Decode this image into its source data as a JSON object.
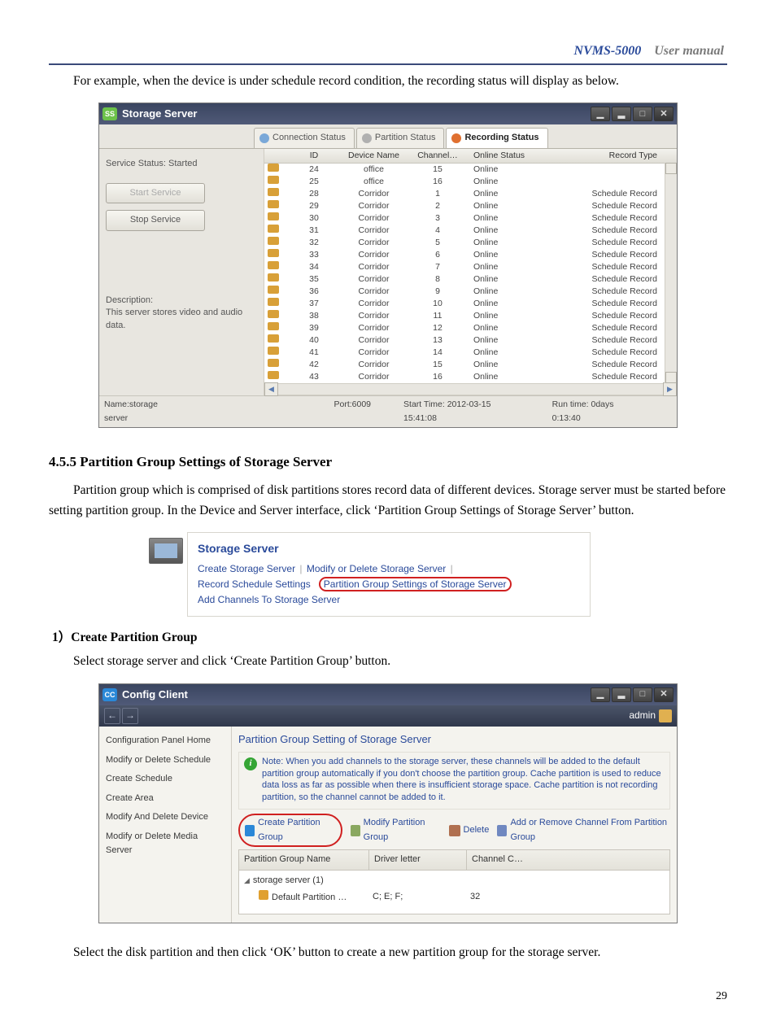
{
  "header": {
    "product": "NVMS-5000",
    "label": "User manual"
  },
  "intro": "For example, when the device is under schedule record condition, the recording status will display as below.",
  "ss_window": {
    "title": "Storage Server",
    "tabs": {
      "conn": "Connection Status",
      "part": "Partition Status",
      "rec": "Recording Status"
    },
    "service_status_label": "Service Status: Started",
    "start_btn": "Start Service",
    "stop_btn": "Stop Service",
    "desc_label": "Description:",
    "desc_text": "This server stores video and audio data.",
    "columns": {
      "id": "ID",
      "dev": "Device Name",
      "chan": "Channel…",
      "online": "Online Status",
      "rec": "Record Type"
    },
    "footer": {
      "name": "Name:storage server",
      "port": "Port:6009",
      "start": "Start Time: 2012-03-15 15:41:08",
      "run": "Run time: 0days 0:13:40"
    },
    "rows": [
      {
        "id": "24",
        "dev": "office",
        "chan": "15",
        "online": "Online",
        "rec": ""
      },
      {
        "id": "25",
        "dev": "office",
        "chan": "16",
        "online": "Online",
        "rec": ""
      },
      {
        "id": "28",
        "dev": "Corridor",
        "chan": "1",
        "online": "Online",
        "rec": "Schedule Record"
      },
      {
        "id": "29",
        "dev": "Corridor",
        "chan": "2",
        "online": "Online",
        "rec": "Schedule Record"
      },
      {
        "id": "30",
        "dev": "Corridor",
        "chan": "3",
        "online": "Online",
        "rec": "Schedule Record"
      },
      {
        "id": "31",
        "dev": "Corridor",
        "chan": "4",
        "online": "Online",
        "rec": "Schedule Record"
      },
      {
        "id": "32",
        "dev": "Corridor",
        "chan": "5",
        "online": "Online",
        "rec": "Schedule Record"
      },
      {
        "id": "33",
        "dev": "Corridor",
        "chan": "6",
        "online": "Online",
        "rec": "Schedule Record"
      },
      {
        "id": "34",
        "dev": "Corridor",
        "chan": "7",
        "online": "Online",
        "rec": "Schedule Record"
      },
      {
        "id": "35",
        "dev": "Corridor",
        "chan": "8",
        "online": "Online",
        "rec": "Schedule Record"
      },
      {
        "id": "36",
        "dev": "Corridor",
        "chan": "9",
        "online": "Online",
        "rec": "Schedule Record"
      },
      {
        "id": "37",
        "dev": "Corridor",
        "chan": "10",
        "online": "Online",
        "rec": "Schedule Record"
      },
      {
        "id": "38",
        "dev": "Corridor",
        "chan": "11",
        "online": "Online",
        "rec": "Schedule Record"
      },
      {
        "id": "39",
        "dev": "Corridor",
        "chan": "12",
        "online": "Online",
        "rec": "Schedule Record"
      },
      {
        "id": "40",
        "dev": "Corridor",
        "chan": "13",
        "online": "Online",
        "rec": "Schedule Record"
      },
      {
        "id": "41",
        "dev": "Corridor",
        "chan": "14",
        "online": "Online",
        "rec": "Schedule Record"
      },
      {
        "id": "42",
        "dev": "Corridor",
        "chan": "15",
        "online": "Online",
        "rec": "Schedule Record"
      },
      {
        "id": "43",
        "dev": "Corridor",
        "chan": "16",
        "online": "Online",
        "rec": "Schedule Record"
      }
    ]
  },
  "section": "4.5.5 Partition Group Settings of Storage Server",
  "section_para": "Partition group which is comprised of disk partitions stores record data of different devices. Storage server must be started before setting partition group. In the Device and Server interface, click ‘Partition Group Settings of Storage Server’ button.",
  "links_block": {
    "title": "Storage Server",
    "create": "Create Storage Server",
    "modify": "Modify or Delete Storage Server",
    "sched": "Record Schedule Settings",
    "part": "Partition Group Settings of Storage Server",
    "add": "Add Channels To Storage Server"
  },
  "sub1_h": "1）Create Partition Group",
  "sub1_p": "Select storage server and click ‘Create Partition Group’ button.",
  "cc_window": {
    "title": "Config Client",
    "user": "admin",
    "side": [
      "Configuration Panel Home",
      "Modify or Delete Schedule",
      "Create Schedule",
      "Create Area",
      "Modify And Delete Device",
      "Modify or Delete Media Server"
    ],
    "pg_title": "Partition Group Setting of Storage Server",
    "note": "Note: When you add channels to the storage server, these channels will be added to the default partition group automatically if you don't choose the partition group. Cache partition is used to reduce data loss as far as possible when there is insufficient storage space. Cache partition is not recording partition, so the channel cannot be added to it.",
    "toolbar": {
      "create": "Create Partition Group",
      "modify": "Modify Partition Group",
      "delete": "Delete",
      "addrem": "Add or Remove Channel From Partition Group"
    },
    "cols": {
      "name": "Partition Group Name",
      "drv": "Driver letter",
      "chan": "Channel C…"
    },
    "tree": {
      "server": "storage server (1)",
      "part_name": "Default Partition …",
      "part_drv": "C; E; F;",
      "part_chan": "32"
    }
  },
  "sub1_tail": "Select the disk partition and then click ‘OK’ button to create a new partition group for the storage server.",
  "page_num": "29"
}
